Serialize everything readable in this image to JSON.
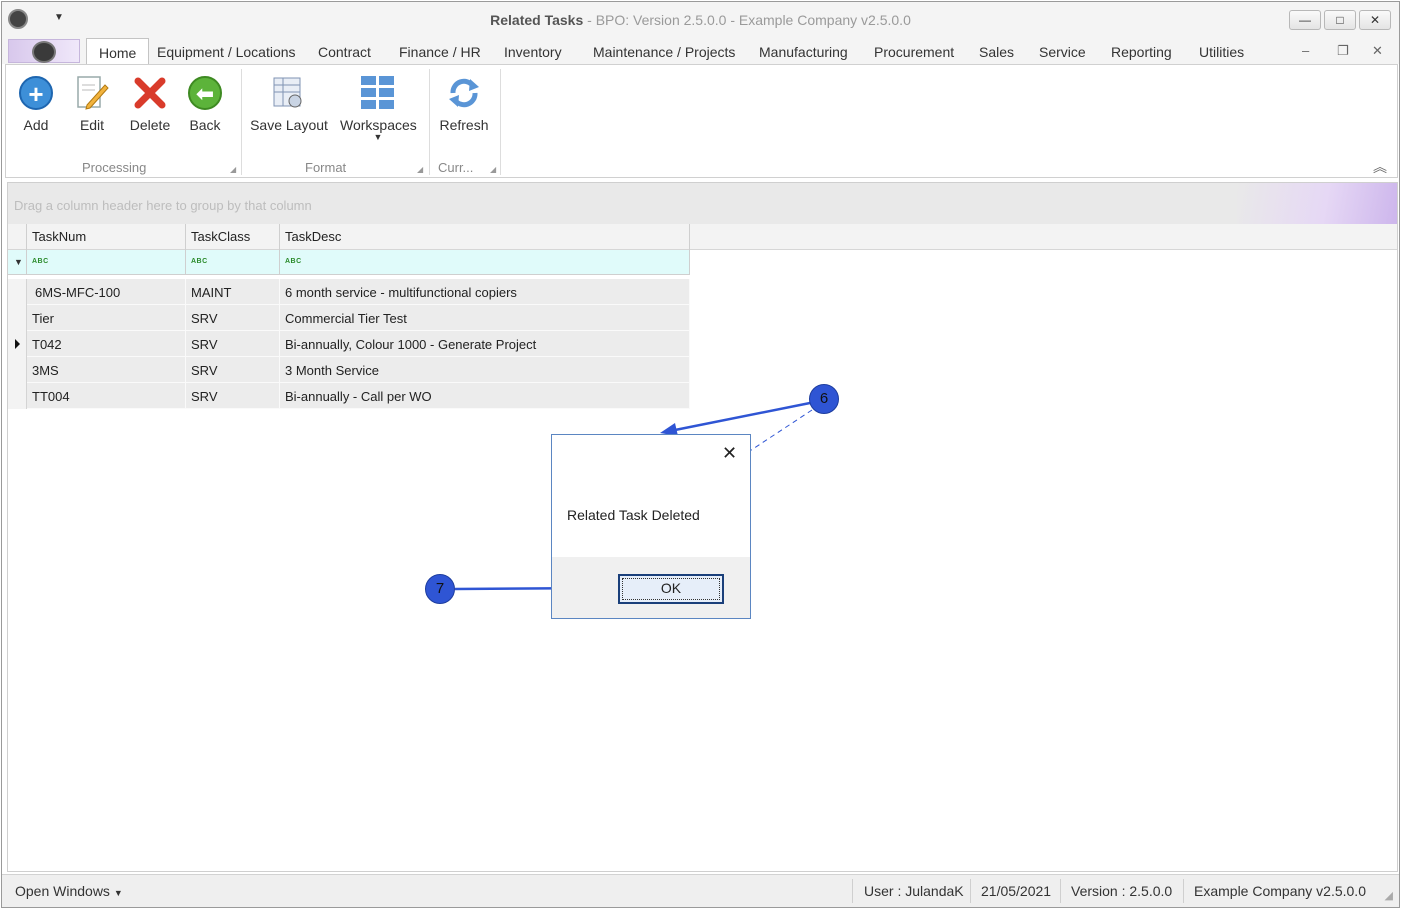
{
  "window": {
    "title_main": "Related Tasks",
    "title_rest": " - BPO: Version 2.5.0.0 - Example Company v2.5.0.0",
    "buttons": {
      "minimize": "—",
      "restore": "□",
      "close": "✕"
    }
  },
  "tabs": {
    "items": [
      "Home",
      "Equipment / Locations",
      "Contract",
      "Finance / HR",
      "Inventory",
      "Maintenance / Projects",
      "Manufacturing",
      "Procurement",
      "Sales",
      "Service",
      "Reporting",
      "Utilities"
    ],
    "active": "Home",
    "mdi": {
      "minimize": "–",
      "restore": "❐",
      "close": "✕"
    }
  },
  "ribbon": {
    "buttons": {
      "add": "Add",
      "edit": "Edit",
      "delete": "Delete",
      "back": "Back",
      "save_layout": "Save Layout",
      "workspaces": "Workspaces",
      "refresh": "Refresh"
    },
    "groups": {
      "processing": "Processing",
      "format": "Format",
      "currency": "Curr..."
    },
    "icons": {
      "add": "plus-circle-icon",
      "edit": "pencil-document-icon",
      "delete": "red-x-icon",
      "back": "back-arrow-icon",
      "save_layout": "grid-save-icon",
      "workspaces": "workspaces-grid-icon",
      "refresh": "refresh-icon"
    },
    "colors": {
      "add": "#3d8fd8",
      "delete": "#d93b2b",
      "back": "#5cb33a",
      "workspaces": "#5a95d6"
    }
  },
  "grid": {
    "group_hint": "Drag a column header here to group by that column",
    "columns": [
      "TaskNum",
      "TaskClass",
      "TaskDesc"
    ],
    "filter_icon": "abc-filter-icon",
    "rows": [
      {
        "TaskNum": "6MS-MFC-100",
        "TaskClass": "MAINT",
        "TaskDesc": "6 month service - multifunctional copiers",
        "current": false
      },
      {
        "TaskNum": "Tier",
        "TaskClass": "SRV",
        "TaskDesc": "Commercial Tier Test",
        "current": false
      },
      {
        "TaskNum": "T042",
        "TaskClass": "SRV",
        "TaskDesc": "Bi-annually, Colour 1000 - Generate Project",
        "current": true
      },
      {
        "TaskNum": "3MS",
        "TaskClass": "SRV",
        "TaskDesc": "3 Month Service",
        "current": false
      },
      {
        "TaskNum": "TT004",
        "TaskClass": "SRV",
        "TaskDesc": "Bi-annually - Call per WO",
        "current": false
      }
    ]
  },
  "dialog": {
    "message": "Related Task Deleted",
    "ok_label": "OK",
    "close_glyph": "✕"
  },
  "callouts": {
    "step6": "6",
    "step7": "7",
    "color": "#2f55d4"
  },
  "statusbar": {
    "open_windows": "Open Windows",
    "user": "User : JulandaK",
    "date": "21/05/2021",
    "version": "Version : 2.5.0.0",
    "company": "Example Company v2.5.0.0"
  }
}
